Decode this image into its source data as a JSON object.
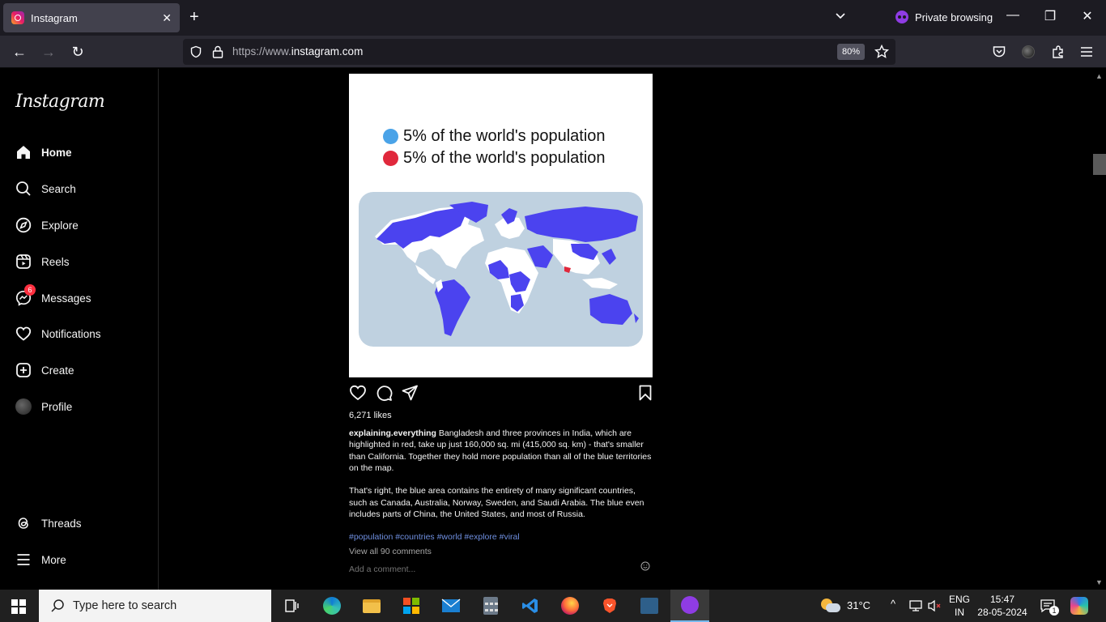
{
  "browser": {
    "tab": {
      "title": "Instagram"
    },
    "private_label": "Private browsing",
    "url_prefix": "https://www.",
    "url_domain": "instagram.com",
    "zoom": "80%"
  },
  "sidebar": {
    "logo": "Instagram",
    "items": [
      {
        "label": "Home",
        "icon": "home-icon"
      },
      {
        "label": "Search",
        "icon": "search-icon"
      },
      {
        "label": "Explore",
        "icon": "compass-icon"
      },
      {
        "label": "Reels",
        "icon": "reels-icon"
      },
      {
        "label": "Messages",
        "icon": "messenger-icon",
        "badge": "6"
      },
      {
        "label": "Notifications",
        "icon": "heart-icon"
      },
      {
        "label": "Create",
        "icon": "plus-square-icon"
      },
      {
        "label": "Profile",
        "icon": "avatar"
      }
    ],
    "bottom": [
      {
        "label": "Threads",
        "icon": "threads-icon"
      },
      {
        "label": "More",
        "icon": "menu-icon"
      }
    ]
  },
  "post": {
    "image": {
      "legend": [
        {
          "text": "5% of the world's population",
          "color": "#4aa3e8"
        },
        {
          "text": "5% of the world's population",
          "color": "#e0283c"
        }
      ],
      "map_colors": {
        "ocean": "#bfd1e0",
        "highlight_blue": "#4b43ef",
        "highlight_red": "#e0283c"
      }
    },
    "likes": "6,271 likes",
    "username": "explaining.everything",
    "caption_1": " Bangladesh and three provinces in India, which are highlighted in red, take up just 160,000 sq. mi (415,000 sq. km) - that's smaller than California. Together they hold more population than all of the blue territories on the map.",
    "caption_2": "That's right, the blue area contains the entirety of many significant countries, such as Canada, Australia, Norway, Sweden, and Saudi Arabia. The blue even includes parts of China, the United States, and most of Russia.",
    "hashtags": "#population #countries #world #explore #viral",
    "view_comments": "View all 90 comments",
    "comment_placeholder": "Add a comment..."
  },
  "taskbar": {
    "search_placeholder": "Type here to search",
    "weather": "31°C",
    "language_1": "ENG",
    "language_2": "IN",
    "time": "15:47",
    "date": "28-05-2024",
    "notification_count": "1"
  }
}
